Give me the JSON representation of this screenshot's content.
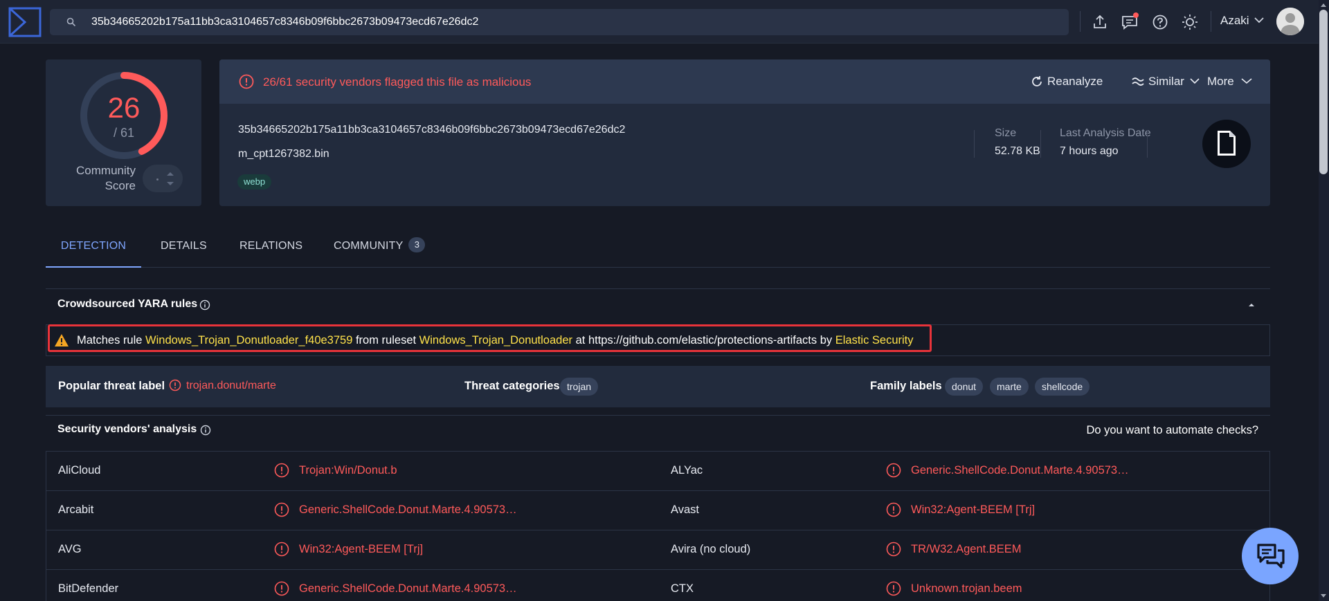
{
  "search": {
    "value": "35b34665202b175a11bb3ca3104657c8346b09f6bbc2673b09473ecd67e26dc2",
    "placeholder": "URL, IP address, domain or file hash"
  },
  "topbar": {
    "icons": [
      "upload-icon",
      "chat-icon",
      "help-icon",
      "theme-icon"
    ],
    "user_name": "Azaki"
  },
  "score": {
    "detections": "26",
    "total": "/ 61",
    "detections_ratio": 0.4262,
    "community_label_line1": "Community",
    "community_label_line2": "Score"
  },
  "alert": {
    "text": "26/61 security vendors flagged this file as malicious",
    "color": "#ff5a5a"
  },
  "actions": {
    "reanalyze": "Reanalyze",
    "similar": "Similar",
    "more": "More"
  },
  "file": {
    "hash": "35b34665202b175a11bb3ca3104657c8346b09f6bbc2673b09473ecd67e26dc2",
    "name": "m_cpt1267382.bin",
    "tag": "webp",
    "size_label": "Size",
    "size_value": "52.78 KB",
    "date_label": "Last Analysis Date",
    "date_value": "7 hours ago",
    "type_icon": "file-icon"
  },
  "tabs": [
    {
      "label": "DETECTION"
    },
    {
      "label": "DETAILS"
    },
    {
      "label": "RELATIONS"
    },
    {
      "label": "COMMUNITY",
      "count": "3"
    }
  ],
  "yara": {
    "title": "Crowdsourced YARA rules",
    "prefix": "Matches rule ",
    "rule": "Windows_Trojan_Donutloader_f40e3759",
    "mid": " from ruleset ",
    "ruleset": "Windows_Trojan_Donutloader",
    "at": " at ",
    "url": "https://github.com/elastic/protections-artifacts",
    "by": " by ",
    "author": "Elastic Security"
  },
  "threat": {
    "popular_label": "Popular threat label",
    "popular_value": "trojan.donut/marte",
    "categories_label": "Threat categories",
    "categories": [
      "trojan"
    ],
    "family_label": "Family labels",
    "families": [
      "donut",
      "marte",
      "shellcode"
    ]
  },
  "vendors": {
    "title": "Security vendors' analysis",
    "automate": "Do you want to automate checks?",
    "rows": [
      {
        "left_name": "AliCloud",
        "left_result": "Trojan:Win/Donut.b",
        "right_name": "ALYac",
        "right_result": "Generic.ShellCode.Donut.Marte.4.90573…"
      },
      {
        "left_name": "Arcabit",
        "left_result": "Generic.ShellCode.Donut.Marte.4.90573…",
        "right_name": "Avast",
        "right_result": "Win32:Agent-BEEM [Trj]"
      },
      {
        "left_name": "AVG",
        "left_result": "Win32:Agent-BEEM [Trj]",
        "right_name": "Avira (no cloud)",
        "right_result": "TR/W32.Agent.BEEM"
      },
      {
        "left_name": "BitDefender",
        "left_result": "Generic.ShellCode.Donut.Marte.4.90573…",
        "right_name": "CTX",
        "right_result": "Unknown.trojan.beem"
      }
    ]
  },
  "colors": {
    "accent": "#7fa6ff",
    "malicious": "#ff5a5a",
    "highlight": "#ffe24a",
    "highlight_box": "#e8333a"
  }
}
